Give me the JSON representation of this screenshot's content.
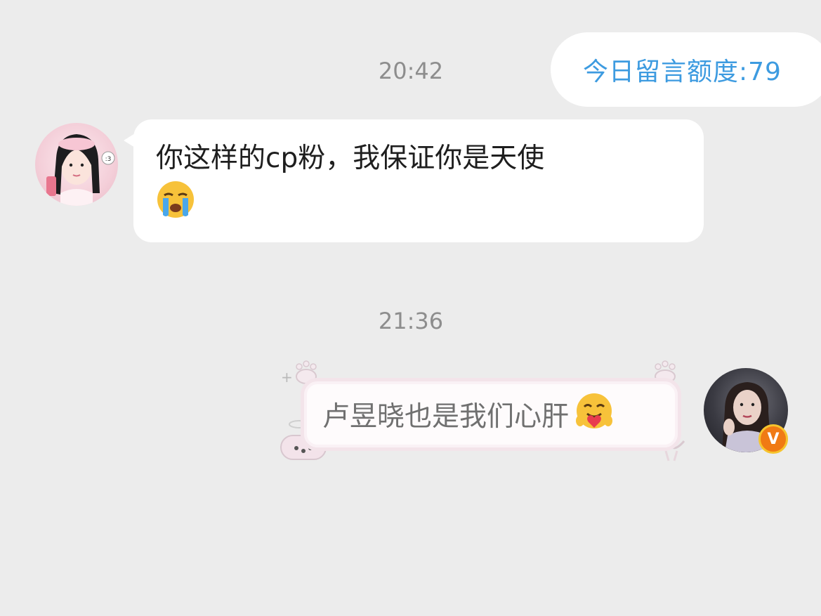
{
  "header": {
    "quota_text": "今日留言额度:79"
  },
  "messages": [
    {
      "time": "20:42",
      "text": "你这样的cp粉，我保证你是天使",
      "emoji": "loudly-crying-face"
    },
    {
      "time": "21:36",
      "text": "卢昱晓也是我们心肝",
      "emoji": "smiling-face-with-hearts-hugging"
    }
  ],
  "badges": {
    "verified_letter": "V"
  },
  "colors": {
    "quota_text": "#3d9be0",
    "background": "#ececec",
    "bubble": "#ffffff",
    "verified": "#f07a14"
  }
}
